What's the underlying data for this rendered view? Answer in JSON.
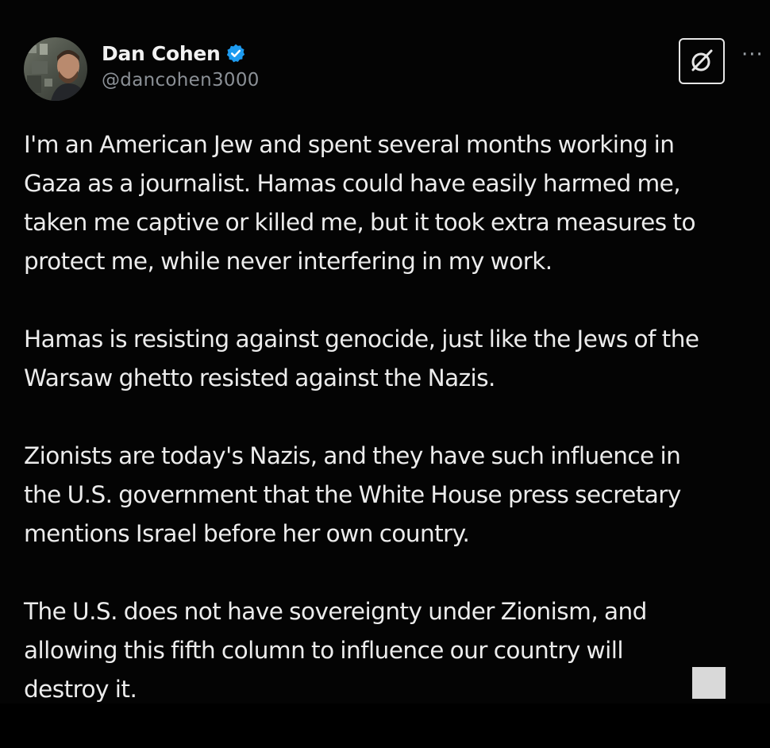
{
  "post": {
    "author": {
      "display_name": "Dan Cohen",
      "handle": "@dancohen3000",
      "verified_icon": "verified-badge-icon",
      "verified_color": "#1d9bf0"
    },
    "actions": {
      "grok_icon": "grok-icon",
      "more_label": "···"
    },
    "paragraphs": [
      {
        "lines": [
          "I'm an American Jew and spent several months working in",
          "Gaza as a journalist. Hamas could have easily harmed me,",
          "taken me captive or killed me, but it took extra measures to",
          "protect me, while never interfering in my work."
        ]
      },
      {
        "lines": [
          "Hamas is resisting against genocide, just like the Jews of the",
          "Warsaw ghetto resisted against the Nazis."
        ]
      },
      {
        "lines": [
          "Zionists are today's Nazis, and they have such influence in",
          "the U.S. government that the White House press secretary",
          "mentions Israel before her own country."
        ]
      },
      {
        "lines": [
          "The U.S. does not have sovereignty under Zionism, and",
          "allowing this fifth column to influence our country will",
          "destroy it."
        ]
      }
    ]
  },
  "colors": {
    "background": "#000000",
    "text": "#ececec",
    "handle": "#8b9096",
    "accent": "#1d9bf0"
  }
}
